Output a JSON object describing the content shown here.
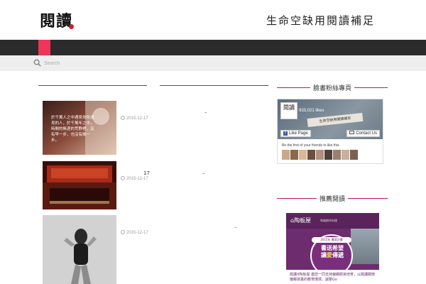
{
  "header": {
    "logo": "閱讀",
    "tagline": "生命空缺用閱讀補足"
  },
  "search": {
    "placeholder": "Search"
  },
  "posts": [
    {
      "date": "2015-12-17",
      "thumb_text": "於千萬人之中遇見你所遇見的人，於千萬年之中，時間的無涯的荒野裡，沒有早一步，也沒有晚一步。"
    },
    {
      "date": "2015-12-17"
    },
    {
      "date": "2015-12-17"
    }
  ],
  "misc": {
    "number": "17",
    "dash": "–"
  },
  "sidebar": {
    "widget1_title": "臉書粉絲專頁",
    "widget2_title": "推薦閱讀",
    "fb": {
      "logo": "閱讀",
      "likes": "933,021 likes",
      "cover_paper": "生命空缺用閱讀補足",
      "like_button": "Like Page",
      "contact_button": "Contact Us",
      "friends_text": "Be the first of your friends to like this"
    },
    "promo": {
      "brand": "陶板屋",
      "brand_sub": "和風創作料理",
      "pill": "2015年 書寫計畫",
      "main_line1": "書送希望",
      "main_line2_a": "讓",
      "main_line2_b": "愛",
      "main_line2_c": "傳遞",
      "body": "閱讀X陶板屋 邀您一同支持偏鄉師資培育，以閱讀關懷偏鄉孩童的教育環境，誠摯Go"
    }
  },
  "colors": {
    "accent": "#f0345a",
    "divider": "#c2185b",
    "navbar": "#2b2b2b",
    "searchbar": "#eeeeee",
    "promo": "#6d2c6e"
  }
}
